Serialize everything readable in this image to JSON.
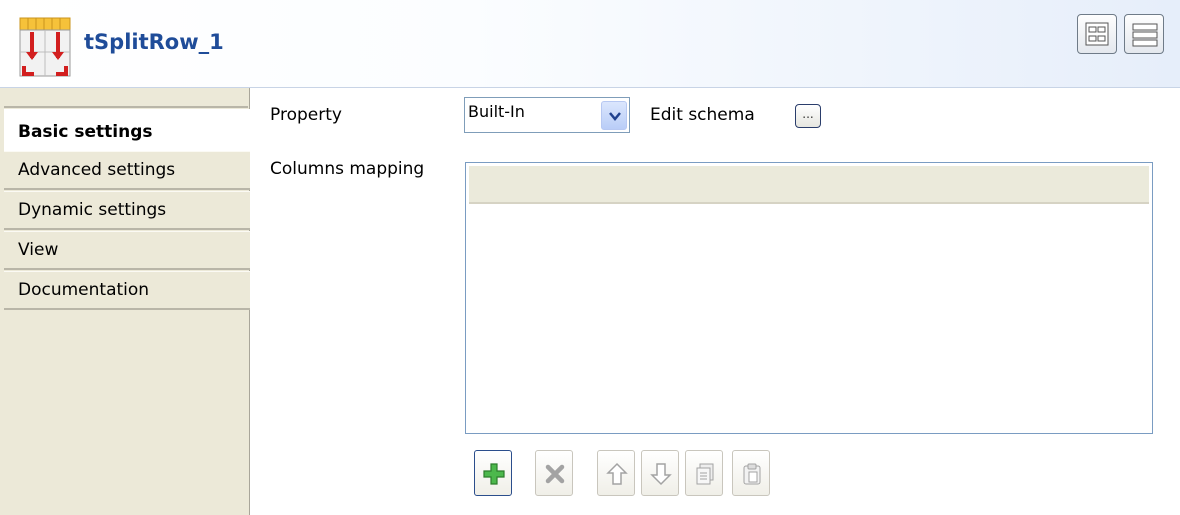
{
  "header": {
    "title": "tSplitRow_1",
    "component_icon": "tsplitrow-component-icon",
    "layout_buttons": [
      "grid-layout-icon",
      "list-layout-icon"
    ]
  },
  "sidebar": {
    "tabs": [
      {
        "label": "Basic settings",
        "active": true
      },
      {
        "label": "Advanced settings",
        "active": false
      },
      {
        "label": "Dynamic settings",
        "active": false
      },
      {
        "label": "View",
        "active": false
      },
      {
        "label": "Documentation",
        "active": false
      }
    ]
  },
  "main": {
    "property_label": "Property",
    "property_value": "Built-In",
    "edit_schema_label": "Edit schema",
    "edit_schema_button": "...",
    "columns_mapping_label": "Columns mapping",
    "toolbar": [
      {
        "icon": "add-icon",
        "enabled": true
      },
      {
        "icon": "delete-icon",
        "enabled": false
      },
      {
        "icon": "move-up-icon",
        "enabled": false
      },
      {
        "icon": "move-down-icon",
        "enabled": false
      },
      {
        "icon": "copy-icon",
        "enabled": false
      },
      {
        "icon": "paste-icon",
        "enabled": false
      }
    ]
  },
  "colors": {
    "title": "#1f4c99",
    "tab_background": "#ece9d8",
    "add_icon": "#3aa43a"
  }
}
